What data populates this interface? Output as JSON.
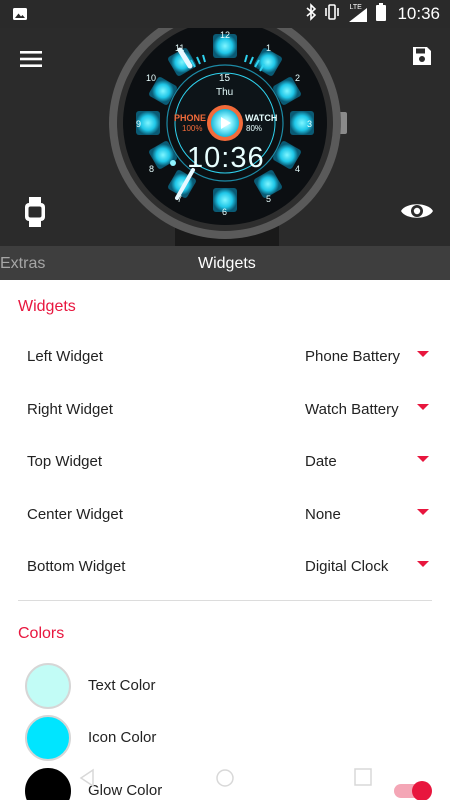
{
  "status_bar": {
    "time": "10:36",
    "network": "LTE",
    "icons": [
      "image-icon",
      "bluetooth-icon",
      "vibrate-icon",
      "lte-signal-icon",
      "battery-icon"
    ]
  },
  "header": {
    "icons": [
      "menu-icon",
      "save-icon",
      "watch-icon",
      "eye-icon"
    ]
  },
  "watch_face": {
    "hour_numbers": [
      "12",
      "1",
      "2",
      "3",
      "4",
      "5",
      "6",
      "7",
      "8",
      "9",
      "10",
      "11"
    ],
    "day_number": "15",
    "day_name": "Thu",
    "left_label": "PHONE",
    "left_value": "100%",
    "right_label": "WATCH",
    "right_value": "80%",
    "time": "10:36",
    "colors": {
      "accent": "#22d3ee",
      "phone": "#f26b3a",
      "watch": "#e8ffff"
    }
  },
  "tabs": [
    {
      "label": "Extras"
    },
    {
      "label": "Widgets"
    }
  ],
  "widgets_section": {
    "title": "Widgets",
    "rows": [
      {
        "label": "Left Widget",
        "value": "Phone Battery"
      },
      {
        "label": "Right Widget",
        "value": "Watch Battery"
      },
      {
        "label": "Top Widget",
        "value": "Date"
      },
      {
        "label": "Center Widget",
        "value": "None"
      },
      {
        "label": "Bottom Widget",
        "value": "Digital Clock"
      }
    ]
  },
  "colors_section": {
    "title": "Colors",
    "rows": [
      {
        "label": "Text Color",
        "color": "#c2fcf6"
      },
      {
        "label": "Icon Color",
        "color": "#00e5ff"
      },
      {
        "label": "Glow Color",
        "color": "#000000"
      }
    ]
  },
  "toggle": {
    "on": true
  },
  "theme": {
    "accent": "#e8163e",
    "dark": "#2b2b2b",
    "tabbar": "#3e3e3e"
  }
}
